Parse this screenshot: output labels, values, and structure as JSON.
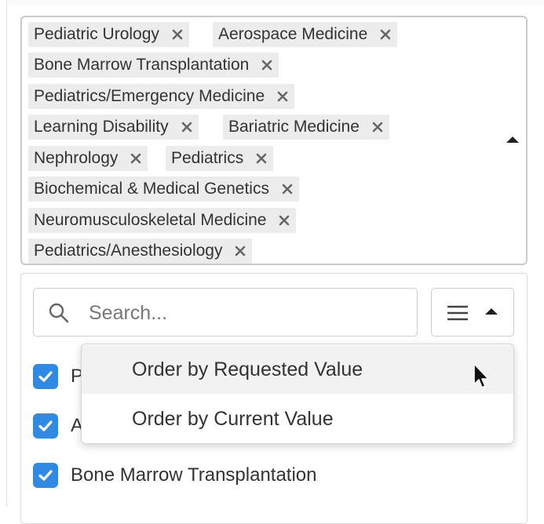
{
  "selected_chips": [
    "Pediatric Urology",
    "Aerospace Medicine",
    "Bone Marrow Transplantation",
    "Pediatrics/Emergency Medicine",
    "Learning Disability",
    "Bariatric Medicine",
    "Nephrology",
    "Pediatrics",
    "Biochemical & Medical Genetics",
    "Neuromusculoskeletal Medicine",
    "Pediatrics/Anesthesiology"
  ],
  "search": {
    "placeholder": "Search...",
    "value": ""
  },
  "sort_menu": {
    "items": [
      "Order by Requested Value",
      "Order by Current Value"
    ],
    "hovered_index": 0
  },
  "options": [
    {
      "label": "P",
      "checked": true
    },
    {
      "label": "A",
      "checked": true
    },
    {
      "label": "Bone Marrow Transplantation",
      "checked": true
    }
  ],
  "colors": {
    "checkbox": "#2f8ae3",
    "chip_bg": "#ececec",
    "border": "#cbcbcb"
  }
}
